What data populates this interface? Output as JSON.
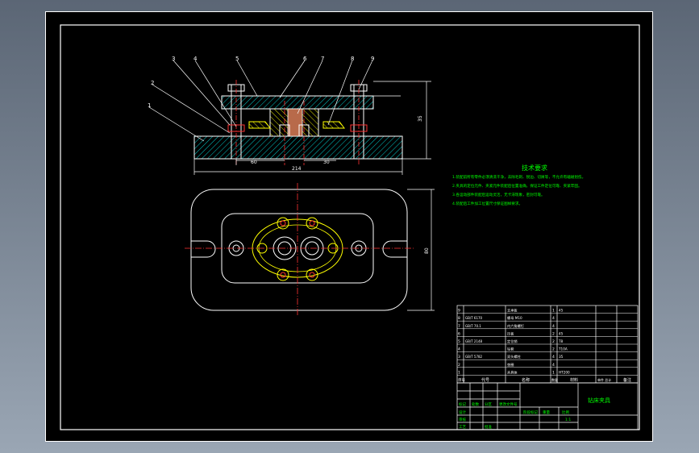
{
  "callouts": [
    "3",
    "4",
    "5",
    "6",
    "7",
    "8",
    "9",
    "2",
    "1"
  ],
  "tech": {
    "title": "技术要求",
    "lines": [
      "1.装配前所有零件必须清洗干净，去除毛刺、锐边、切屑等，不允许有磕碰划伤。",
      "2.夹具的定位元件、夹紧元件装配后位置准确，保证工件定位可靠、夹紧牢固。",
      "3.各运动部件装配后运动灵活，无卡滞现象，密封可靠。",
      "4.装配后工件加工位置尺寸保证图样要求。"
    ]
  },
  "dims": {
    "top_height": "35",
    "plan_height": "80",
    "bottom_width": "214",
    "left_small": "60",
    "right_small": "30"
  },
  "bom": {
    "rows": [
      {
        "no": "9",
        "code": "",
        "name": "支承板",
        "qty": "1",
        "material": "45",
        "note": ""
      },
      {
        "no": "8",
        "code": "GB/T 6170",
        "name": "螺母 M10",
        "qty": "4",
        "material": "",
        "note": ""
      },
      {
        "no": "7",
        "code": "GB/T 70.1",
        "name": "内六角螺钉",
        "qty": "4",
        "material": "",
        "note": ""
      },
      {
        "no": "6",
        "code": "",
        "name": "压板",
        "qty": "2",
        "material": "45",
        "note": ""
      },
      {
        "no": "5",
        "code": "GB/T 2148",
        "name": "定位销",
        "qty": "2",
        "material": "T8",
        "note": ""
      },
      {
        "no": "4",
        "code": "",
        "name": "钻套",
        "qty": "2",
        "material": "T10A",
        "note": ""
      },
      {
        "no": "3",
        "code": "GB/T 5782",
        "name": "双头螺柱",
        "qty": "4",
        "material": "35",
        "note": ""
      },
      {
        "no": "2",
        "code": "",
        "name": "垫圈",
        "qty": "4",
        "material": "",
        "note": ""
      },
      {
        "no": "1",
        "code": "",
        "name": "夹具体",
        "qty": "1",
        "material": "HT200",
        "note": ""
      }
    ],
    "header": {
      "no": "序号",
      "code": "代号",
      "name": "名称",
      "qty": "数量",
      "material": "材料",
      "weight": "单件 总计",
      "note": "备注"
    }
  },
  "title_block": {
    "name": "钻床夹具",
    "labels": [
      "标记",
      "处数",
      "分区",
      "更改文件号",
      "签名",
      "年月日",
      "设计",
      "审核",
      "工艺",
      "批准"
    ],
    "scale_labels": [
      "阶段标记",
      "重量",
      "比例"
    ],
    "scale": "1:1"
  }
}
